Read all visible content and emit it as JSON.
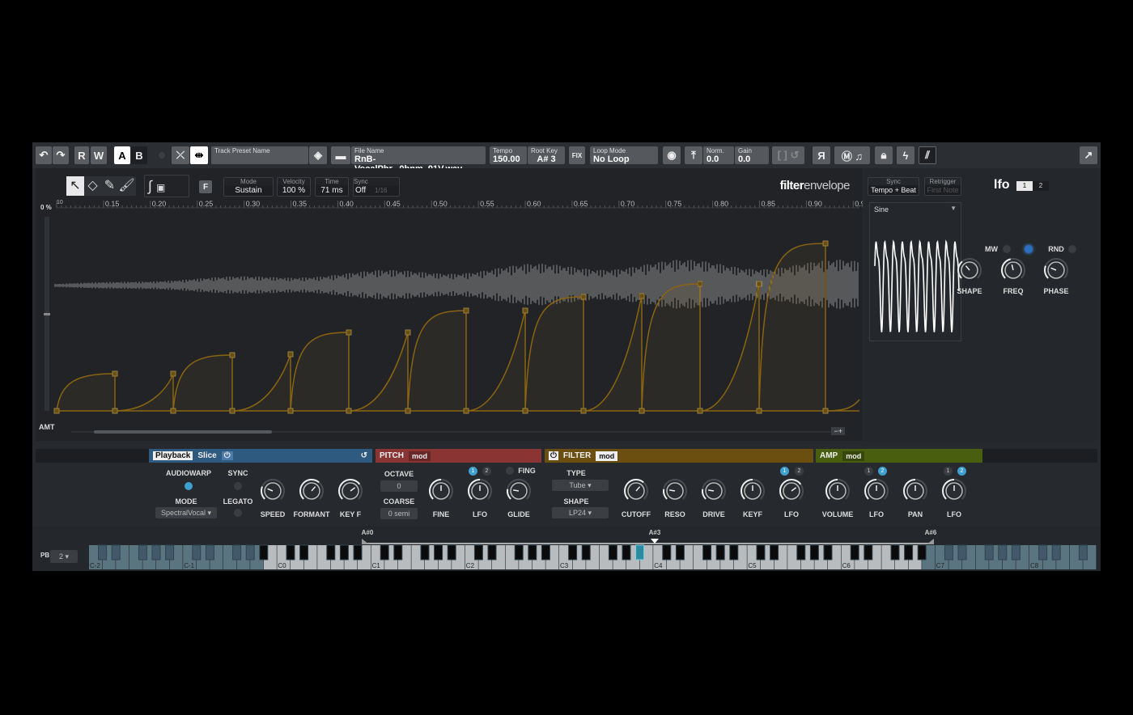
{
  "toolbar": {
    "r": "R",
    "w": "W",
    "a": "A",
    "b": "B",
    "preset_label": "Track Preset Name",
    "preset_value": "",
    "file_label": "File Name",
    "file_value": "RnB-VocalPhr...0bpm_91V.wav",
    "tempo_label": "Tempo",
    "tempo_value": "150.00",
    "rootkey_label": "Root Key",
    "rootkey_value": "A# 3",
    "fix": "FIX",
    "loop_label": "Loop Mode",
    "loop_value": "No Loop",
    "norm_label": "Norm.",
    "norm_value": "0.0",
    "gain_label": "Gain",
    "gain_value": "0.0",
    "reverse": "Я"
  },
  "envelope": {
    "mode_label": "Mode",
    "mode_value": "Sustain",
    "velocity_label": "Velocity",
    "velocity_value": "100 %",
    "time_label": "Time",
    "time_value": "71 ms",
    "sync_label": "Sync",
    "sync_value": "Off",
    "sync_grid": "1/16",
    "f_button": "F",
    "title_bold": "filter",
    "title_light": "envelope",
    "level": "0 %",
    "amt": "AMT",
    "ruler": [
      "10",
      "0.15",
      "0.20",
      "0.25",
      "0.30",
      "0.35",
      "0.40",
      "0.45",
      "0.50",
      "0.55",
      "0.60",
      "0.65",
      "0.70",
      "0.75",
      "0.80",
      "0.85",
      "0.90",
      "0.95"
    ],
    "color": "#8a6410"
  },
  "lfo": {
    "sync_label": "Sync",
    "sync_value": "Tempo + Beat",
    "retrig_label": "Retrigger",
    "retrig_value": "First Note",
    "title": "lfo",
    "tab1": "1",
    "tab2": "2",
    "waveform": "Sine",
    "mw": "MW",
    "rnd": "RND",
    "knobs": [
      {
        "label": "SHAPE",
        "value": 0.35
      },
      {
        "label": "FREQ",
        "value": 0.45
      },
      {
        "label": "PHASE",
        "value": 0.25
      }
    ]
  },
  "playback": {
    "tab1": "Playback",
    "tab2": "Slice",
    "color": "#2f5a80",
    "audiowarp": "AUDIOWARP",
    "sync": "SYNC",
    "mode": "MODE",
    "mode_value": "SpectralVocal",
    "legato": "LEGATO",
    "knobs": [
      {
        "label": "SPEED",
        "value": 0.25
      },
      {
        "label": "FORMANT",
        "value": 0.65
      },
      {
        "label": "KEY F",
        "value": 0.7
      }
    ]
  },
  "pitch": {
    "title": "PITCH",
    "mod": "mod",
    "color": "#8a3434",
    "octave": "OCTAVE",
    "octave_value": "0",
    "coarse": "COARSE",
    "coarse_value": "0 semi",
    "fing": "FING",
    "knobs": [
      {
        "label": "FINE",
        "value": 0.5
      },
      {
        "label": "LFO",
        "value": 0.5
      },
      {
        "label": "GLIDE",
        "value": 0.2
      }
    ]
  },
  "filter": {
    "title": "FILTER",
    "mod": "mod",
    "color": "#6a4f10",
    "type": "TYPE",
    "type_value": "Tube",
    "shape": "SHAPE",
    "shape_value": "LP24",
    "knobs": [
      {
        "label": "CUTOFF",
        "value": 0.65
      },
      {
        "label": "RESO",
        "value": 0.2
      },
      {
        "label": "DRIVE",
        "value": 0.2
      },
      {
        "label": "KEYF",
        "value": 0.5
      },
      {
        "label": "LFO",
        "value": 0.7
      }
    ]
  },
  "amp": {
    "title": "AMP",
    "mod": "mod",
    "color": "#4a5e10",
    "knobs": [
      {
        "label": "VOLUME",
        "value": 0.5
      },
      {
        "label": "LFO",
        "value": 0.5
      },
      {
        "label": "PAN",
        "value": 0.5
      },
      {
        "label": "LFO",
        "value": 0.5
      }
    ]
  },
  "keyboard": {
    "pb_label": "PB",
    "pb_value": "2",
    "low": "A#0",
    "root": "A#3",
    "high": "A#6",
    "octaves": [
      "C-2",
      "C-1",
      "C0",
      "C1",
      "C2",
      "C3",
      "C4",
      "C5",
      "C6",
      "C7",
      "C8"
    ]
  }
}
